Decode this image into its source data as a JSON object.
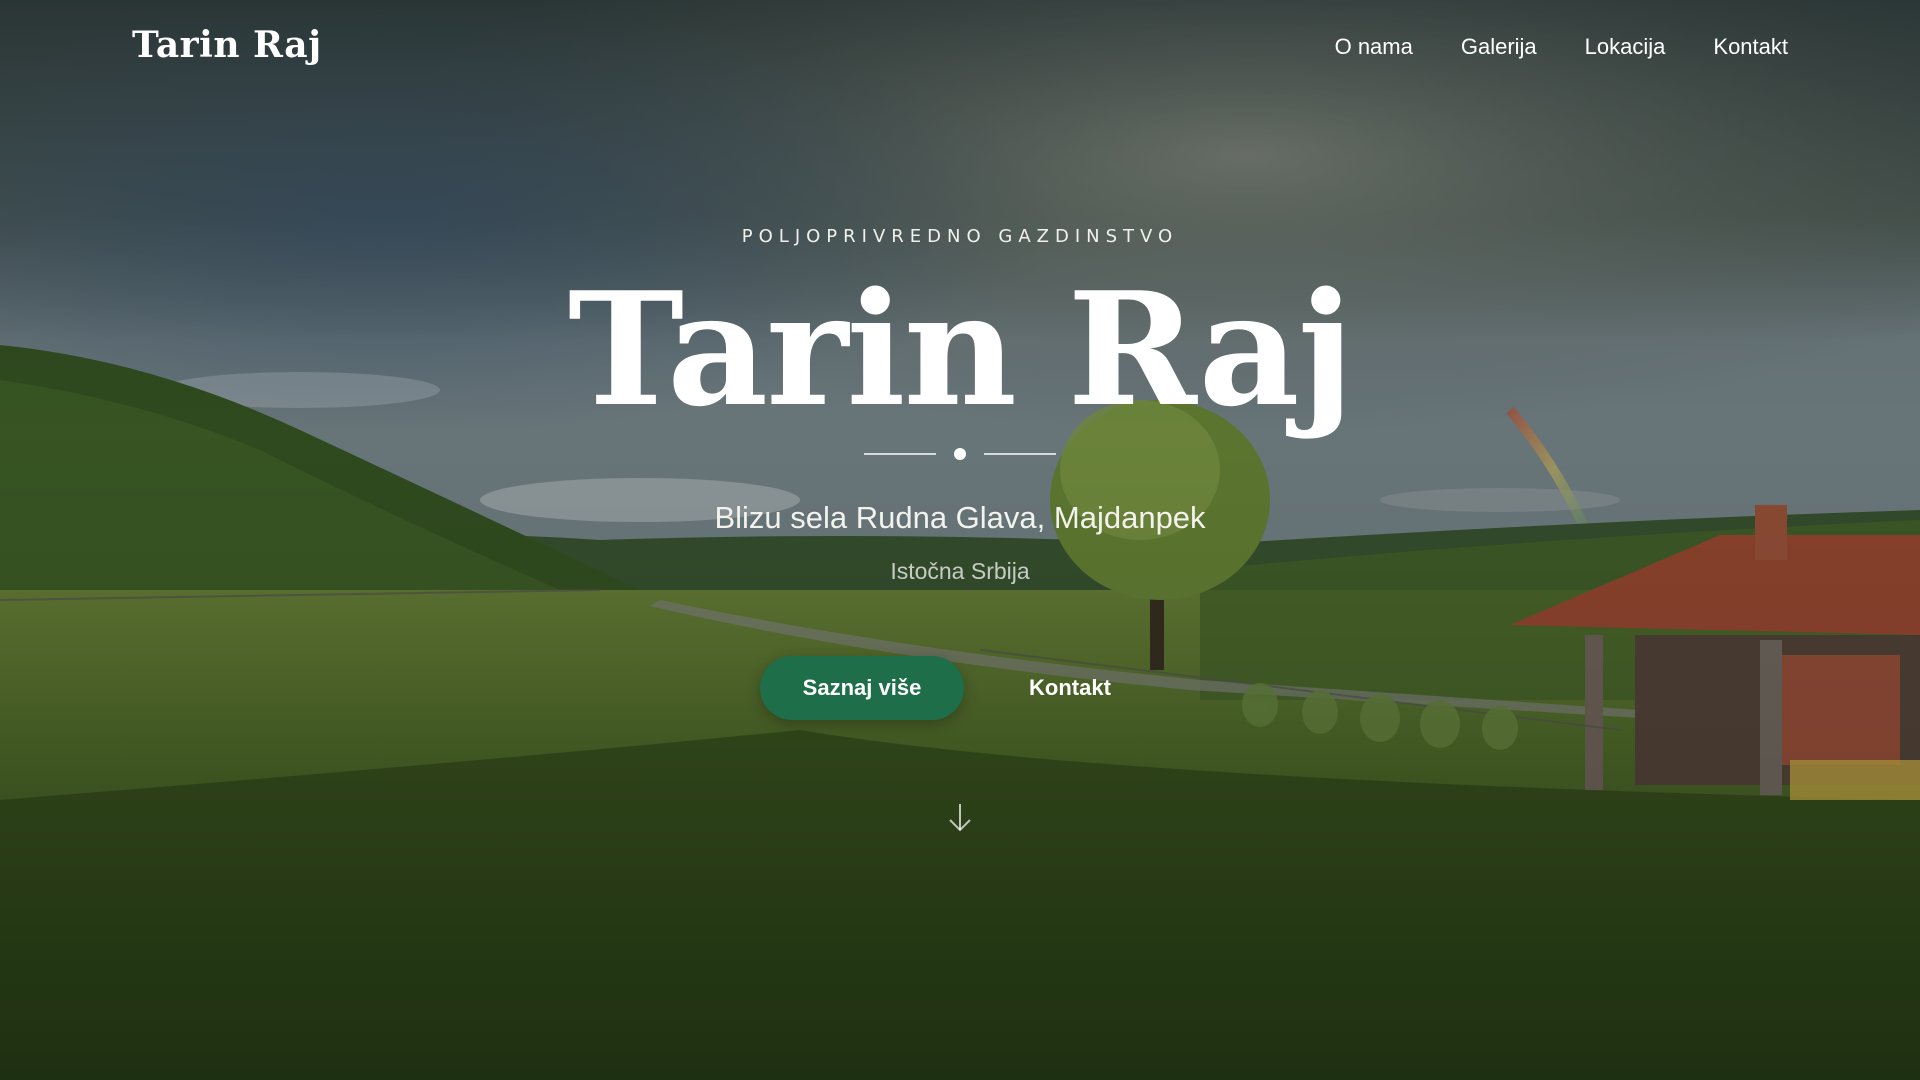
{
  "nav": {
    "brand": "Tarin Raj",
    "items": [
      {
        "label": "O nama"
      },
      {
        "label": "Galerija"
      },
      {
        "label": "Lokacija"
      },
      {
        "label": "Kontakt"
      }
    ]
  },
  "hero": {
    "eyebrow": "POLJOPRIVREDNO GAZDINSTVO",
    "title": "Tarin Raj",
    "location": "Blizu sela Rudna Glava, Majdanpek",
    "region": "Istočna Srbija",
    "primary_button": "Saznaj više",
    "secondary_button": "Kontakt",
    "scroll_icon": "arrow-down-icon"
  },
  "colors": {
    "accent": "#1e6e4a",
    "text": "#ffffff"
  }
}
